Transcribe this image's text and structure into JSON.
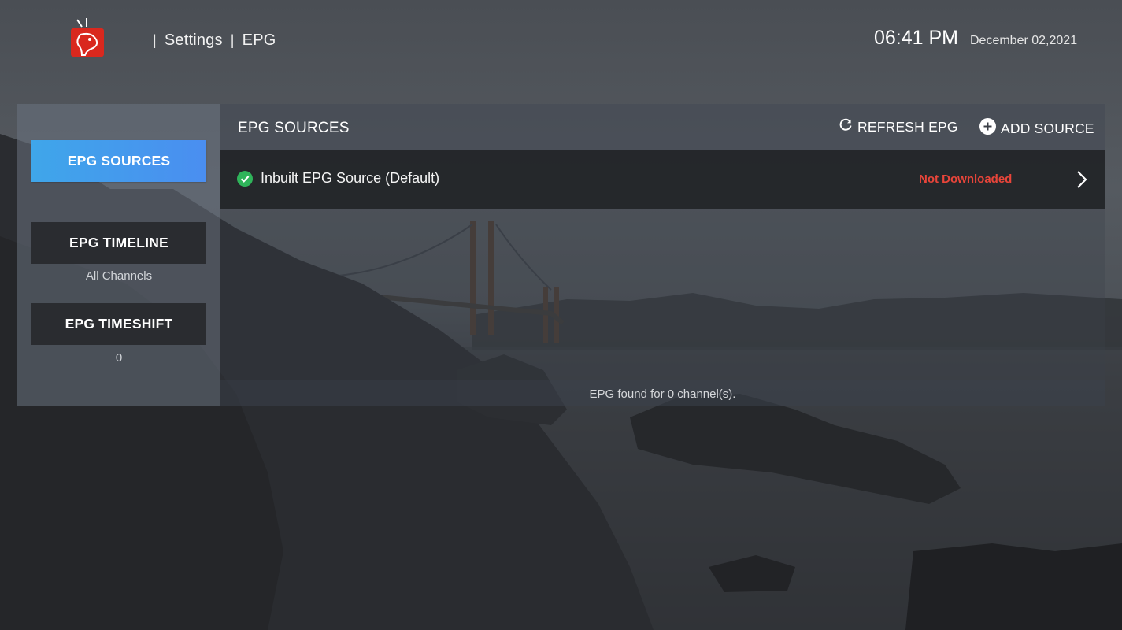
{
  "header": {
    "breadcrumb": [
      "Settings",
      "EPG"
    ],
    "separator": "|",
    "time": "06:41 PM",
    "date": "December 02,2021"
  },
  "sidebar": {
    "items": [
      {
        "label": "EPG SOURCES",
        "subtitle": "",
        "active": true
      },
      {
        "label": "EPG TIMELINE",
        "subtitle": "All Channels",
        "active": false
      },
      {
        "label": "EPG TIMESHIFT",
        "subtitle": "0",
        "active": false
      }
    ]
  },
  "main": {
    "title": "EPG SOURCES",
    "refresh_label": "REFRESH EPG",
    "add_label": "ADD SOURCE",
    "sources": [
      {
        "name": "Inbuilt EPG Source (Default)",
        "status": "Not Downloaded",
        "check_icon": "check-circle-icon"
      }
    ],
    "footer_text": "EPG found for 0 channel(s)."
  },
  "colors": {
    "accent": "#4a8ef0",
    "status_error": "#e9453a",
    "check_green": "#2fb45a",
    "logo_red": "#d9281e"
  }
}
